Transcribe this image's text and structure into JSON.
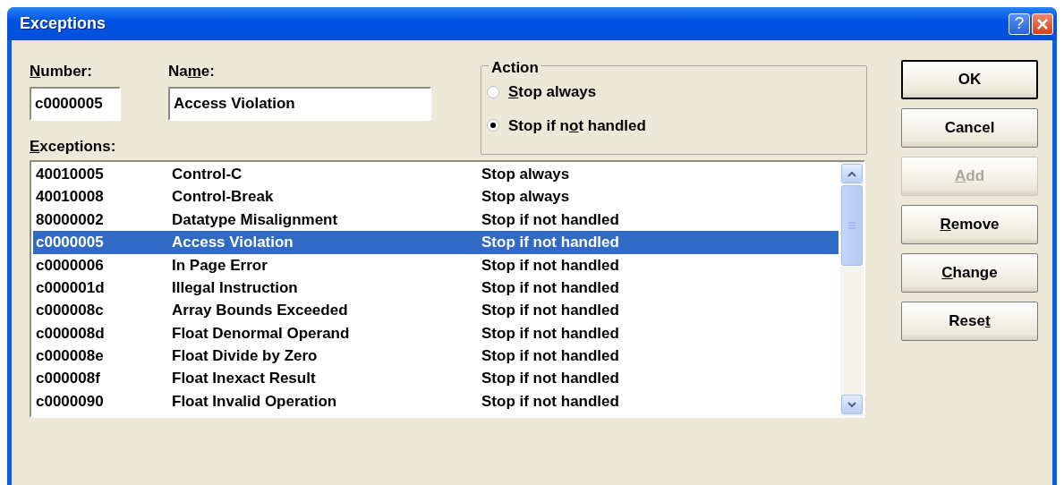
{
  "window": {
    "title": "Exceptions",
    "help_button": "?"
  },
  "number": {
    "label": {
      "key": "N",
      "after": "umber:"
    },
    "value": "c0000005"
  },
  "name": {
    "label": {
      "before": "Na",
      "key": "m",
      "after": "e:"
    },
    "value": "Access Violation"
  },
  "action": {
    "title": "Action",
    "options": [
      {
        "label": {
          "key": "S",
          "after": "top always"
        },
        "selected": false
      },
      {
        "label": {
          "before": "Stop if n",
          "key": "o",
          "after": "t handled"
        },
        "selected": true
      }
    ]
  },
  "exceptions": {
    "label": {
      "key": "E",
      "after": "xceptions:"
    },
    "rows": [
      {
        "code": "40010005",
        "name": "Control-C",
        "action": "Stop always",
        "selected": false
      },
      {
        "code": "40010008",
        "name": "Control-Break",
        "action": "Stop always",
        "selected": false
      },
      {
        "code": "80000002",
        "name": "Datatype Misalignment",
        "action": "Stop if not handled",
        "selected": false
      },
      {
        "code": "c0000005",
        "name": "Access Violation",
        "action": "Stop if not handled",
        "selected": true
      },
      {
        "code": "c0000006",
        "name": "In Page Error",
        "action": "Stop if not handled",
        "selected": false
      },
      {
        "code": "c000001d",
        "name": "Illegal Instruction",
        "action": "Stop if not handled",
        "selected": false
      },
      {
        "code": "c000008c",
        "name": "Array Bounds Exceeded",
        "action": "Stop if not handled",
        "selected": false
      },
      {
        "code": "c000008d",
        "name": "Float Denormal Operand",
        "action": "Stop if not handled",
        "selected": false
      },
      {
        "code": "c000008e",
        "name": "Float Divide by Zero",
        "action": "Stop if not handled",
        "selected": false
      },
      {
        "code": "c000008f",
        "name": "Float Inexact Result",
        "action": "Stop if not handled",
        "selected": false
      },
      {
        "code": "c0000090",
        "name": "Float Invalid Operation",
        "action": "Stop if not handled",
        "selected": false
      }
    ]
  },
  "buttons": [
    {
      "label": {
        "before": "OK"
      },
      "default": true,
      "disabled": false
    },
    {
      "label": {
        "before": "Cancel"
      },
      "default": false,
      "disabled": false
    },
    {
      "label": {
        "key": "A",
        "after": "dd"
      },
      "default": false,
      "disabled": true
    },
    {
      "label": {
        "key": "R",
        "after": "emove"
      },
      "default": false,
      "disabled": false
    },
    {
      "label": {
        "key": "C",
        "after": "hange"
      },
      "default": false,
      "disabled": false
    },
    {
      "label": {
        "before": "Rese",
        "key": "t"
      },
      "default": false,
      "disabled": false
    }
  ]
}
